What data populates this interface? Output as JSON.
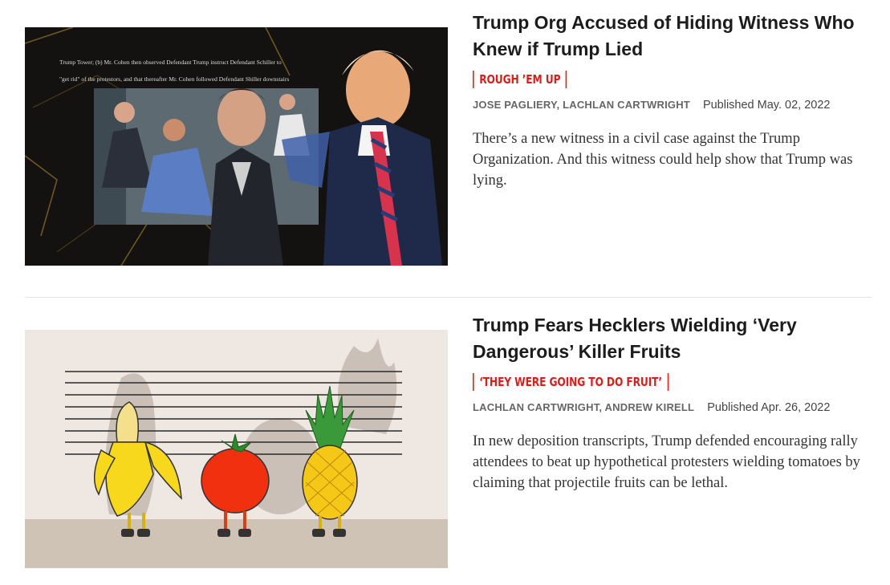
{
  "articles": [
    {
      "headline": "Trump Org Accused of Hiding Witness Who Knew if Trump Lied",
      "rubric": "ROUGH ’EM UP",
      "authors": "JOSE PAGLIERY, LACHLAN CARTWRIGHT",
      "published": "Published May. 02, 2022",
      "dek": "There’s a new witness in a civil case against the Trump Organization. And this witness could help show that Trump was lying.",
      "image_text": [
        "Trump Tower; (b) Mr. Cohen then observed Defendant Trump instruct Defendant Schiller to",
        "\"get rid\" of the protestors, and that thereafter Mr. Cohen followed Defendant Shiller downstairs"
      ]
    },
    {
      "headline": "Trump Fears Hecklers Wielding ‘Very Dangerous’ Killer Fruits",
      "rubric": "‘THEY WERE GOING TO DO FRUIT’",
      "authors": "LACHLAN CARTWRIGHT, ANDREW KIRELL",
      "published": "Published Apr. 26, 2022",
      "dek": "In new deposition transcripts, Trump defended encouraging rally attendees to beat up hypothetical protesters wielding tomatoes by claiming that projectile fruits can be lethal."
    }
  ],
  "colors": {
    "rubric": "#d6201a",
    "headline": "#1c1c1c",
    "divider": "#e3e3e3"
  }
}
